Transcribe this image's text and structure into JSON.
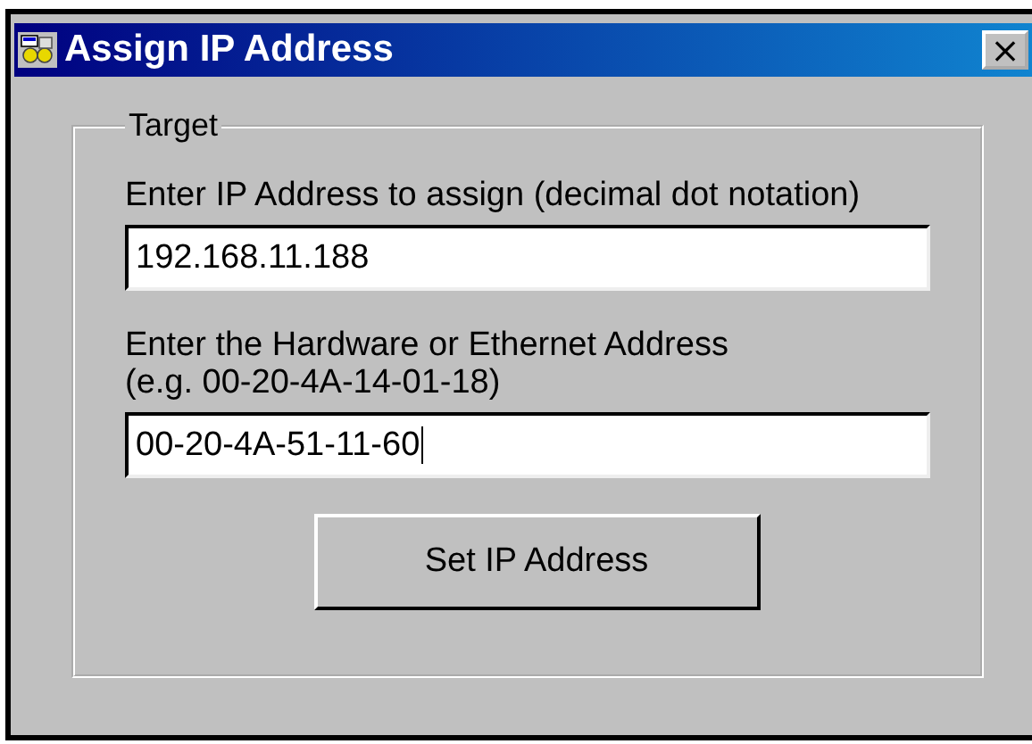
{
  "window": {
    "title": "Assign IP Address",
    "close": "×"
  },
  "group": {
    "title": "Target",
    "fields": [
      {
        "label": "Enter IP Address to assign (decimal dot notation)",
        "value": "192.168.11.188"
      },
      {
        "label": "Enter the Hardware or Ethernet Address\n(e.g. 00-20-4A-14-01-18)",
        "value": "00-20-4A-51-11-60",
        "focused": true
      }
    ],
    "button": "Set IP Address"
  }
}
